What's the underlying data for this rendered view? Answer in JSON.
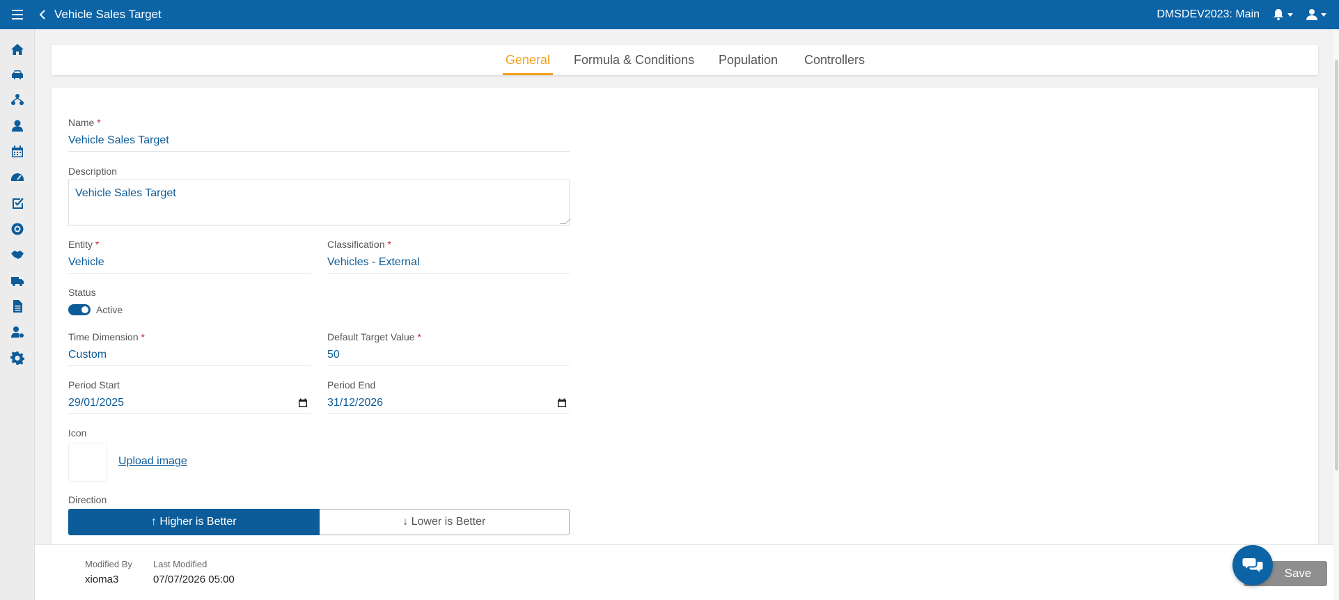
{
  "header": {
    "title": "Vehicle Sales Target",
    "company": "DMSDEV2023: Main"
  },
  "tabs": [
    {
      "label": "General",
      "active": true
    },
    {
      "label": "Formula & Conditions",
      "active": false
    },
    {
      "label": "Population",
      "active": false
    },
    {
      "label": "Controllers",
      "active": false
    }
  ],
  "sidebar": {
    "icons": [
      "home-icon",
      "car-icon",
      "network-icon",
      "users-icon",
      "calendar-icon",
      "speedometer-icon",
      "task-check-icon",
      "tire-icon",
      "handshake-icon",
      "truck-settings-icon",
      "document-icon",
      "user-settings-icon",
      "gear-icon"
    ]
  },
  "form": {
    "name": {
      "label": "Name",
      "required": "*",
      "value": "Vehicle Sales Target"
    },
    "description": {
      "label": "Description",
      "value": "Vehicle Sales Target"
    },
    "entity": {
      "label": "Entity",
      "required": "*",
      "value": "Vehicle"
    },
    "classification": {
      "label": "Classification",
      "required": "*",
      "value": "Vehicles - External"
    },
    "status": {
      "label": "Status",
      "value": "Active",
      "on": true
    },
    "time_dimension": {
      "label": "Time Dimension",
      "required": "*",
      "value": "Custom"
    },
    "default_target": {
      "label": "Default Target Value",
      "required": "*",
      "value": "50"
    },
    "period_start": {
      "label": "Period Start",
      "value": "29/01/2025"
    },
    "period_end": {
      "label": "Period End",
      "value": "31/12/2026"
    },
    "icon": {
      "label": "Icon",
      "upload_label": "Upload image"
    },
    "direction": {
      "label": "Direction",
      "higher": "↑ Higher is Better",
      "lower": "↓ Lower is Better",
      "selected": "higher"
    }
  },
  "footer": {
    "modified_by_label": "Modified By",
    "modified_by_value": "xioma3",
    "last_modified_label": "Last Modified",
    "last_modified_value": "07/07/2026 05:00",
    "save_label": "Save"
  },
  "colors": {
    "primary": "#0c63a6",
    "accent": "#f0a020",
    "required": "#c0282d"
  }
}
